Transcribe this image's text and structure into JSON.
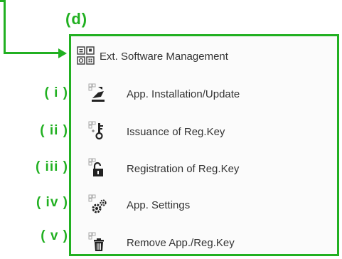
{
  "callout": {
    "label": "(d)"
  },
  "menu": {
    "header": {
      "label": "Ext. Software Management",
      "icon": "ext-software-grid-icon"
    },
    "items": [
      {
        "marker": "( i )",
        "label": "App. Installation/Update",
        "icon": "app-install-icon"
      },
      {
        "marker": "( ii )",
        "label": "Issuance of Reg.Key",
        "icon": "key-issue-icon"
      },
      {
        "marker": "( iii )",
        "label": "Registration of Reg.Key",
        "icon": "lock-icon"
      },
      {
        "marker": "( iv )",
        "label": "App. Settings",
        "icon": "gear-icon"
      },
      {
        "marker": "( v )",
        "label": "Remove App./Reg.Key",
        "icon": "trash-icon"
      }
    ]
  },
  "colors": {
    "accent": "#21b021",
    "text": "#333333"
  }
}
